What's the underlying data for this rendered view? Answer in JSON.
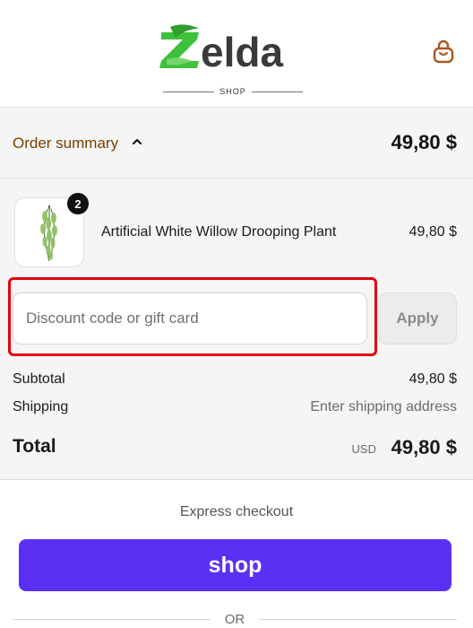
{
  "header": {
    "brand": "Zelda",
    "brand_sub": "SHOP",
    "brand_color": "#3ec13b",
    "cart_icon": "shopping-bag-icon",
    "cart_icon_color": "#a9591c"
  },
  "summary": {
    "toggle_label": "Order summary",
    "toggle_icon": "chevron-up-icon",
    "total_display": "49,80 $",
    "product": {
      "name": "Artificial White Willow Drooping Plant",
      "price": "49,80 $",
      "quantity": "2"
    },
    "discount": {
      "placeholder": "Discount code or gift card",
      "value": "",
      "apply_label": "Apply",
      "highlight_color": "#e3000f"
    },
    "subtotal_label": "Subtotal",
    "subtotal_value": "49,80 $",
    "shipping_label": "Shipping",
    "shipping_value": "Enter shipping address",
    "total_label": "Total",
    "total_currency": "USD",
    "total_value": "49,80 $"
  },
  "checkout": {
    "express_label": "Express checkout",
    "shop_pay_label": "shop",
    "shop_pay_color": "#5a31f4",
    "or_label": "OR"
  }
}
